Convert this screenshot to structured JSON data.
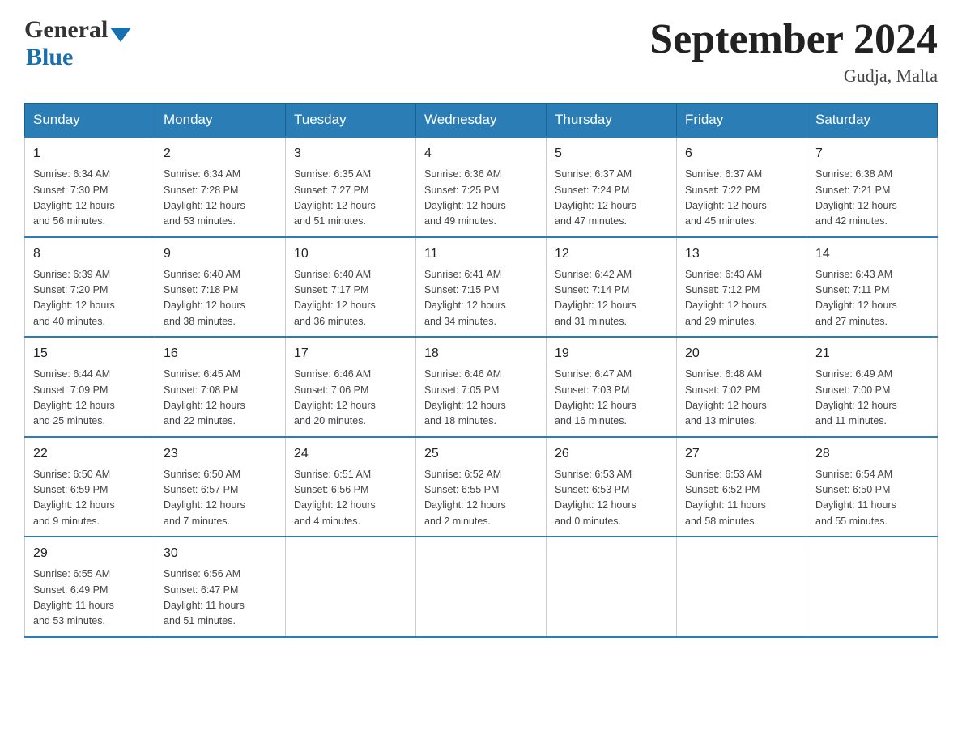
{
  "header": {
    "title": "September 2024",
    "subtitle": "Gudja, Malta",
    "logo_general": "General",
    "logo_blue": "Blue"
  },
  "days_of_week": [
    "Sunday",
    "Monday",
    "Tuesday",
    "Wednesday",
    "Thursday",
    "Friday",
    "Saturday"
  ],
  "weeks": [
    [
      {
        "day": "1",
        "sunrise": "6:34 AM",
        "sunset": "7:30 PM",
        "daylight": "12 hours and 56 minutes."
      },
      {
        "day": "2",
        "sunrise": "6:34 AM",
        "sunset": "7:28 PM",
        "daylight": "12 hours and 53 minutes."
      },
      {
        "day": "3",
        "sunrise": "6:35 AM",
        "sunset": "7:27 PM",
        "daylight": "12 hours and 51 minutes."
      },
      {
        "day": "4",
        "sunrise": "6:36 AM",
        "sunset": "7:25 PM",
        "daylight": "12 hours and 49 minutes."
      },
      {
        "day": "5",
        "sunrise": "6:37 AM",
        "sunset": "7:24 PM",
        "daylight": "12 hours and 47 minutes."
      },
      {
        "day": "6",
        "sunrise": "6:37 AM",
        "sunset": "7:22 PM",
        "daylight": "12 hours and 45 minutes."
      },
      {
        "day": "7",
        "sunrise": "6:38 AM",
        "sunset": "7:21 PM",
        "daylight": "12 hours and 42 minutes."
      }
    ],
    [
      {
        "day": "8",
        "sunrise": "6:39 AM",
        "sunset": "7:20 PM",
        "daylight": "12 hours and 40 minutes."
      },
      {
        "day": "9",
        "sunrise": "6:40 AM",
        "sunset": "7:18 PM",
        "daylight": "12 hours and 38 minutes."
      },
      {
        "day": "10",
        "sunrise": "6:40 AM",
        "sunset": "7:17 PM",
        "daylight": "12 hours and 36 minutes."
      },
      {
        "day": "11",
        "sunrise": "6:41 AM",
        "sunset": "7:15 PM",
        "daylight": "12 hours and 34 minutes."
      },
      {
        "day": "12",
        "sunrise": "6:42 AM",
        "sunset": "7:14 PM",
        "daylight": "12 hours and 31 minutes."
      },
      {
        "day": "13",
        "sunrise": "6:43 AM",
        "sunset": "7:12 PM",
        "daylight": "12 hours and 29 minutes."
      },
      {
        "day": "14",
        "sunrise": "6:43 AM",
        "sunset": "7:11 PM",
        "daylight": "12 hours and 27 minutes."
      }
    ],
    [
      {
        "day": "15",
        "sunrise": "6:44 AM",
        "sunset": "7:09 PM",
        "daylight": "12 hours and 25 minutes."
      },
      {
        "day": "16",
        "sunrise": "6:45 AM",
        "sunset": "7:08 PM",
        "daylight": "12 hours and 22 minutes."
      },
      {
        "day": "17",
        "sunrise": "6:46 AM",
        "sunset": "7:06 PM",
        "daylight": "12 hours and 20 minutes."
      },
      {
        "day": "18",
        "sunrise": "6:46 AM",
        "sunset": "7:05 PM",
        "daylight": "12 hours and 18 minutes."
      },
      {
        "day": "19",
        "sunrise": "6:47 AM",
        "sunset": "7:03 PM",
        "daylight": "12 hours and 16 minutes."
      },
      {
        "day": "20",
        "sunrise": "6:48 AM",
        "sunset": "7:02 PM",
        "daylight": "12 hours and 13 minutes."
      },
      {
        "day": "21",
        "sunrise": "6:49 AM",
        "sunset": "7:00 PM",
        "daylight": "12 hours and 11 minutes."
      }
    ],
    [
      {
        "day": "22",
        "sunrise": "6:50 AM",
        "sunset": "6:59 PM",
        "daylight": "12 hours and 9 minutes."
      },
      {
        "day": "23",
        "sunrise": "6:50 AM",
        "sunset": "6:57 PM",
        "daylight": "12 hours and 7 minutes."
      },
      {
        "day": "24",
        "sunrise": "6:51 AM",
        "sunset": "6:56 PM",
        "daylight": "12 hours and 4 minutes."
      },
      {
        "day": "25",
        "sunrise": "6:52 AM",
        "sunset": "6:55 PM",
        "daylight": "12 hours and 2 minutes."
      },
      {
        "day": "26",
        "sunrise": "6:53 AM",
        "sunset": "6:53 PM",
        "daylight": "12 hours and 0 minutes."
      },
      {
        "day": "27",
        "sunrise": "6:53 AM",
        "sunset": "6:52 PM",
        "daylight": "11 hours and 58 minutes."
      },
      {
        "day": "28",
        "sunrise": "6:54 AM",
        "sunset": "6:50 PM",
        "daylight": "11 hours and 55 minutes."
      }
    ],
    [
      {
        "day": "29",
        "sunrise": "6:55 AM",
        "sunset": "6:49 PM",
        "daylight": "11 hours and 53 minutes."
      },
      {
        "day": "30",
        "sunrise": "6:56 AM",
        "sunset": "6:47 PM",
        "daylight": "11 hours and 51 minutes."
      },
      null,
      null,
      null,
      null,
      null
    ]
  ],
  "labels": {
    "sunrise": "Sunrise:",
    "sunset": "Sunset:",
    "daylight": "Daylight:"
  }
}
